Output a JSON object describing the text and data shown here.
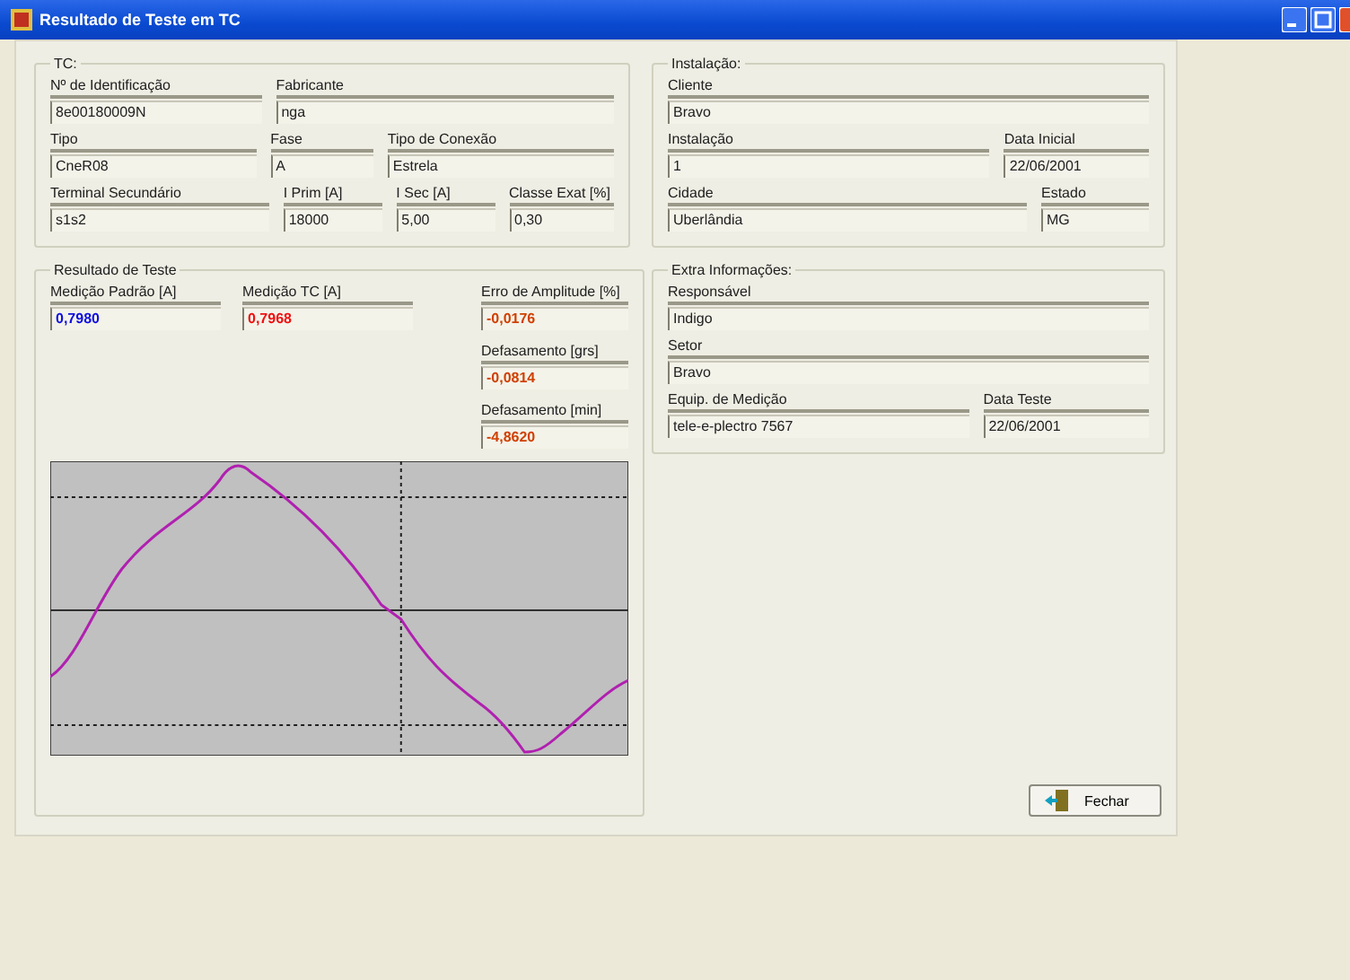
{
  "window": {
    "title": "Resultado de Teste em TC"
  },
  "tc": {
    "title": "TC:",
    "rows": [
      [
        {
          "label": "Nº de Identificação",
          "value": "8e00180009N"
        },
        {
          "label": "Fabricante",
          "value": "nga"
        }
      ],
      [
        {
          "label": "Tipo",
          "value": "CneR08"
        },
        {
          "label": "Fase",
          "value": "A"
        },
        {
          "label": "Tipo de Conexão",
          "value": "Estrela"
        }
      ],
      [
        {
          "label": "Terminal Secundário",
          "value": "s1s2"
        },
        {
          "label": "I Prim [A]",
          "value": "18000"
        },
        {
          "label": "I Sec [A]",
          "value": "5,00"
        },
        {
          "label": "Classe Exat [%]",
          "value": "0,30"
        }
      ]
    ]
  },
  "installation": {
    "title": "Instalação:",
    "rows": [
      [
        {
          "label": "Cliente",
          "value": "Bravo"
        }
      ],
      [
        {
          "label": "Instalação",
          "value": "1"
        },
        {
          "label": "Data Inicial",
          "value": "22/06/2001"
        }
      ],
      [
        {
          "label": "Cidade",
          "value": "Uberlândia"
        },
        {
          "label": "Estado",
          "value": "MG"
        }
      ]
    ]
  },
  "result": {
    "title": "Resultado de Teste",
    "measurements": [
      {
        "label": "Medição Padrão [A]",
        "value": "0,7980",
        "color": "#1010e0"
      },
      {
        "label": "Medição TC [A]",
        "value": "0,7968",
        "color": "#f01010"
      }
    ],
    "errors": [
      {
        "label": "Erro de Amplitude [%]",
        "value": "-0,0176",
        "color": "#d04000"
      },
      {
        "label": "Defasamento [grs]",
        "value": "-0,0814",
        "color": "#d04000"
      },
      {
        "label": "Defasamento [min]",
        "value": "-4,8620",
        "color": "#d04000"
      }
    ]
  },
  "extra": {
    "title": "Extra Informações:",
    "rows": [
      [
        {
          "label": "Responsável",
          "value": "Indigo"
        }
      ],
      [
        {
          "label": "Setor",
          "value": "Bravo"
        }
      ],
      [
        {
          "label": "Equip. de Medição",
          "value": "tele-e-plectro 7567"
        },
        {
          "label": "Data Teste",
          "value": "22/06/2001"
        }
      ]
    ]
  },
  "close_button": {
    "label": "Fechar"
  }
}
